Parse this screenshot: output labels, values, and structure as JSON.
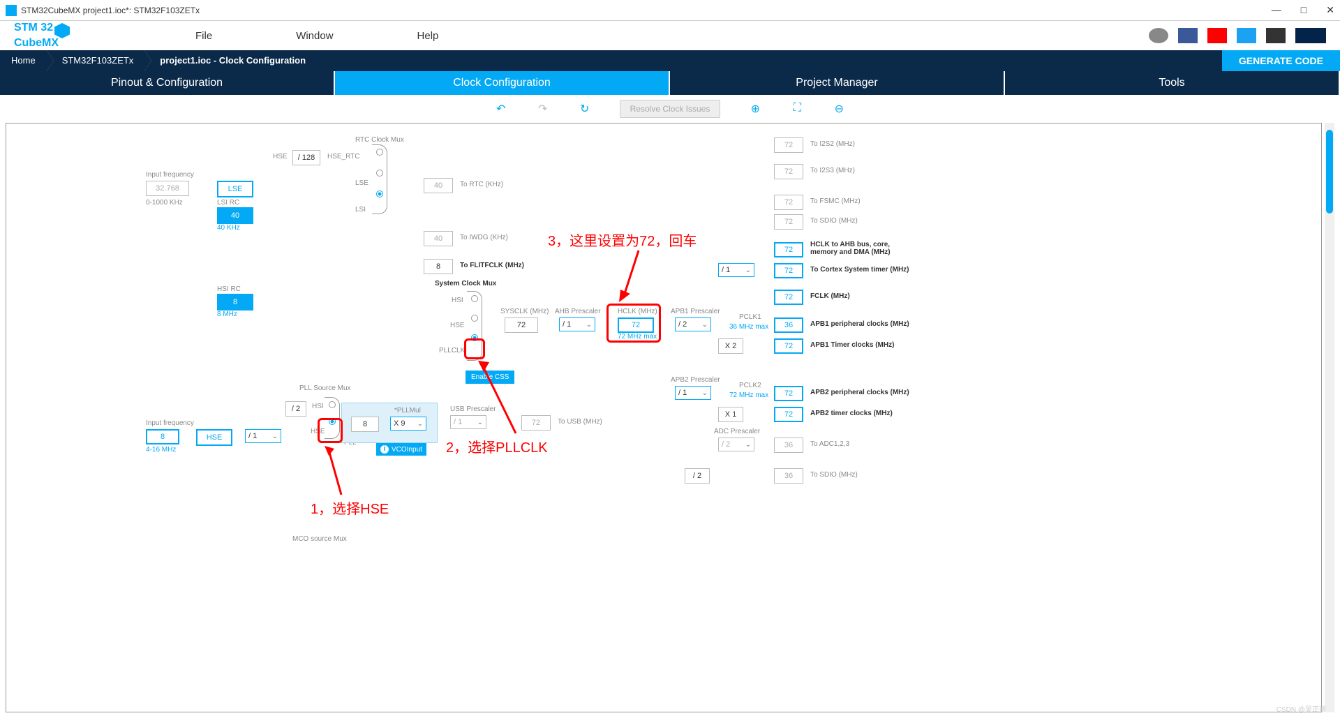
{
  "title": "STM32CubeMX project1.ioc*: STM32F103ZETx",
  "menu": {
    "file": "File",
    "window": "Window",
    "help": "Help"
  },
  "breadcrumb": {
    "home": "Home",
    "chip": "STM32F103ZETx",
    "file": "project1.ioc - Clock Configuration",
    "generate": "GENERATE CODE"
  },
  "tabs": {
    "pinout": "Pinout & Configuration",
    "clock": "Clock Configuration",
    "project": "Project Manager",
    "tools": "Tools"
  },
  "resolve": "Resolve Clock Issues",
  "lse": {
    "inputlabel": "Input frequency",
    "value": "32.768",
    "range": "0-1000 KHz",
    "box": "LSE",
    "lsirc": "LSI RC",
    "lsival": "40",
    "lsihz": "40 KHz"
  },
  "hse": {
    "inputlabel": "Input frequency",
    "value": "8",
    "range": "4-16 MHz",
    "box": "HSE",
    "hsirc": "HSI RC",
    "hsival": "8",
    "hsihz": "8 MHz"
  },
  "rtc": {
    "muxlabel": "RTC Clock Mux",
    "hse": "HSE",
    "div": "/ 128",
    "hsertc": "HSE_RTC",
    "lse": "LSE",
    "lsi": "LSI",
    "rtcval": "40",
    "rtclabel": "To RTC (KHz)",
    "iwdgval": "40",
    "iwdglabel": "To IWDG (KHz)"
  },
  "flitf": {
    "val": "8",
    "label": "To FLITFCLK (MHz)"
  },
  "sysmux": {
    "label": "System Clock Mux",
    "hsi": "HSI",
    "hse": "HSE",
    "pll": "PLLCLK",
    "css": "Enable CSS"
  },
  "pll": {
    "srclabel": "PLL Source Mux",
    "div2": "/ 2",
    "hsi": "HSI",
    "hse": "HSE",
    "plllabel": "PLL",
    "inval": "8",
    "mullabel": "*PLLMul",
    "mulval": "X 9",
    "vco": "VCOInput"
  },
  "hsesel": "/ 1",
  "sysclk": {
    "label": "SYSCLK (MHz)",
    "val": "72"
  },
  "ahb": {
    "label": "AHB Prescaler",
    "val": "/ 1"
  },
  "hclk": {
    "label": "HCLK (MHz)",
    "val": "72",
    "max": "72 MHz max"
  },
  "usb": {
    "prelabel": "USB Prescaler",
    "preval": "/ 1",
    "val": "72",
    "label": "To USB (MHz)"
  },
  "outputs": {
    "i2s2": {
      "val": "72",
      "label": "To I2S2 (MHz)"
    },
    "i2s3": {
      "val": "72",
      "label": "To I2S3 (MHz)"
    },
    "fsmc": {
      "val": "72",
      "label": "To FSMC (MHz)"
    },
    "sdio1": {
      "val": "72",
      "label": "To SDIO (MHz)"
    },
    "ahb": {
      "val": "72",
      "label": "HCLK to AHB bus, core, memory and DMA (MHz)"
    },
    "cortex": {
      "pre": "/ 1",
      "val": "72",
      "label": "To Cortex System timer (MHz)"
    },
    "fclk": {
      "val": "72",
      "label": "FCLK (MHz)"
    },
    "apb1p": {
      "val": "36",
      "label": "APB1 peripheral clocks (MHz)"
    },
    "apb1t": {
      "mul": "X 2",
      "val": "72",
      "label": "APB1 Timer clocks (MHz)"
    },
    "apb2p": {
      "val": "72",
      "label": "APB2 peripheral clocks (MHz)"
    },
    "apb2t": {
      "mul": "X 1",
      "val": "72",
      "label": "APB2 timer clocks (MHz)"
    },
    "adc": {
      "pre": "/ 2",
      "val": "36",
      "label": "To ADC1,2,3"
    },
    "sdio2": {
      "pre": "/ 2",
      "val": "36",
      "label": "To SDIO (MHz)"
    }
  },
  "apb1": {
    "label": "APB1 Prescaler",
    "val": "/ 2",
    "pclk": "PCLK1",
    "max": "36 MHz max"
  },
  "apb2": {
    "label": "APB2 Prescaler",
    "val": "/ 1",
    "pclk": "PCLK2",
    "max": "72 MHz max"
  },
  "adcpre": "ADC Prescaler",
  "mco": "MCO source Mux",
  "annot": {
    "a1": "1，选择HSE",
    "a2": "2，选择PLLCLK",
    "a3": "3，这里设置为72，回车"
  },
  "watermark": "CSDN @吴正豪"
}
